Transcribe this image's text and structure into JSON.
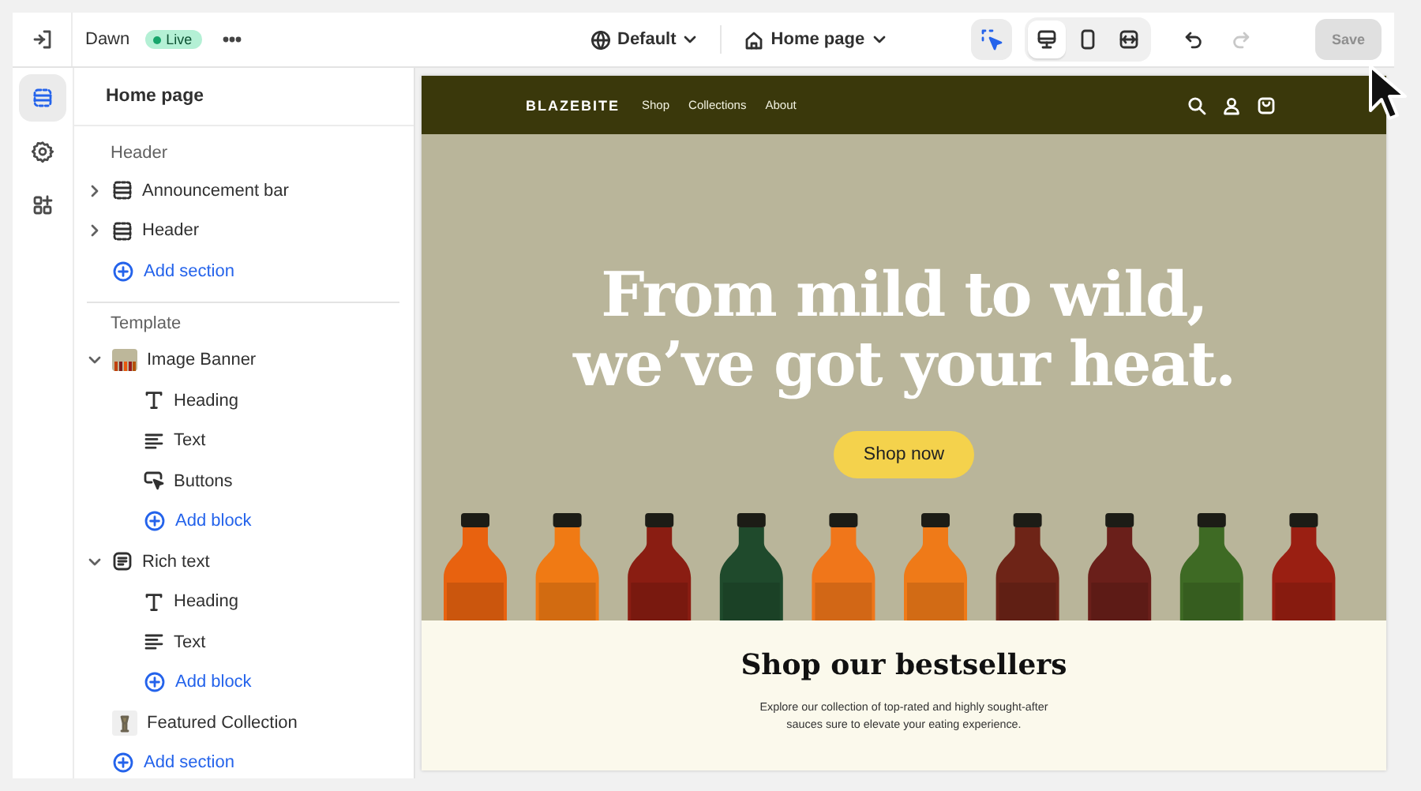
{
  "topbar": {
    "theme_name": "Dawn",
    "status_badge": {
      "label": "Live",
      "live": true
    },
    "theme_selector": "Default",
    "page_selector": "Home page",
    "tools": [
      {
        "kind": "inspect",
        "selected": true
      }
    ],
    "device_toggles": [
      {
        "kind": "desktop",
        "selected": true
      },
      {
        "kind": "mobile",
        "selected": false
      },
      {
        "kind": "fullwidth",
        "selected": false
      }
    ],
    "history": [
      {
        "kind": "undo",
        "disabled": false
      },
      {
        "kind": "redo",
        "disabled": true
      }
    ],
    "save_button": {
      "label": "Save",
      "disabled": true
    }
  },
  "rail": [
    {
      "kind": "sections",
      "selected": true
    },
    {
      "kind": "settings",
      "selected": false
    },
    {
      "kind": "apps",
      "selected": false
    }
  ],
  "sidebar": {
    "title": "Home page",
    "groups": [
      {
        "label": "Header",
        "items": [
          {
            "label": "Announcement bar",
            "kind": "section",
            "expanded": false
          },
          {
            "label": "Header",
            "kind": "section",
            "expanded": false
          },
          {
            "label": "Add section",
            "kind": "add"
          }
        ]
      },
      {
        "label": "Template",
        "items": [
          {
            "label": "Image Banner",
            "kind": "image",
            "expanded": true,
            "children": [
              {
                "label": "Heading",
                "kind": "heading"
              },
              {
                "label": "Text",
                "kind": "text"
              },
              {
                "label": "Buttons",
                "kind": "buttons"
              },
              {
                "label": "Add block",
                "kind": "add"
              }
            ]
          },
          {
            "label": "Rich text",
            "kind": "richtext",
            "expanded": true,
            "children": [
              {
                "label": "Heading",
                "kind": "heading"
              },
              {
                "label": "Text",
                "kind": "text"
              },
              {
                "label": "Add block",
                "kind": "add"
              }
            ]
          },
          {
            "label": "Featured Collection",
            "kind": "collection"
          },
          {
            "label": "Add section",
            "kind": "add"
          }
        ]
      }
    ]
  },
  "preview": {
    "site_header": {
      "logo": "BLAZEBITE",
      "nav": [
        "Shop",
        "Collections",
        "About"
      ]
    },
    "hero": {
      "title_lines": [
        "From mild to wild,",
        "we’ve got your heat."
      ],
      "button": "Shop now"
    },
    "rich_text": {
      "heading": "Shop our bestsellers",
      "body_lines": [
        "Explore our collection of top-rated and highly sought-after",
        "sauces sure to elevate your eating experience."
      ]
    }
  }
}
